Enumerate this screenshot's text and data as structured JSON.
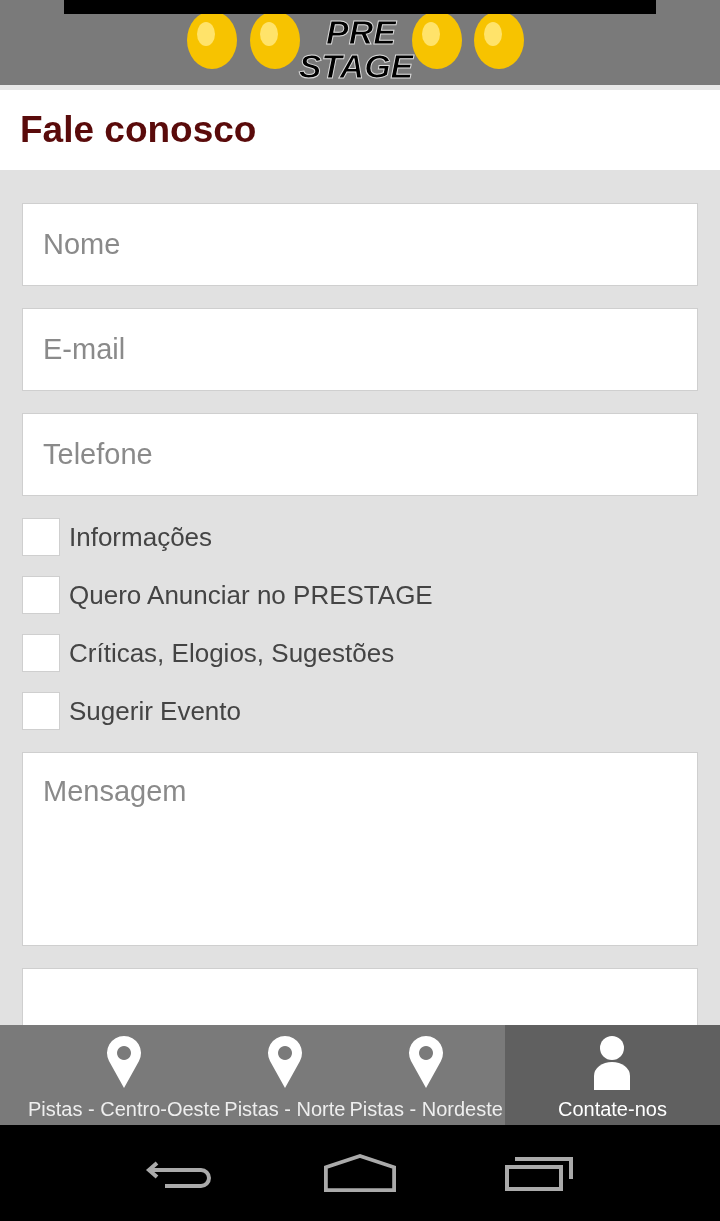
{
  "header": {
    "logo_lines": [
      "PRE",
      "STAGE"
    ]
  },
  "page_title": "Fale conosco",
  "fields": [
    {
      "placeholder": "Nome"
    },
    {
      "placeholder": "E-mail"
    },
    {
      "placeholder": "Telefone"
    }
  ],
  "checkboxes": [
    {
      "label": "Informações",
      "checked": false
    },
    {
      "label": "Quero Anunciar no PRESTAGE",
      "checked": false
    },
    {
      "label": "Críticas, Elogios, Sugestões",
      "checked": false
    },
    {
      "label": "Sugerir Evento",
      "checked": false
    }
  ],
  "message": {
    "placeholder": "Mensagem"
  },
  "bottom_nav": [
    {
      "label": "Pistas - Centro-Oeste",
      "kind": "location",
      "selected": false
    },
    {
      "label": "Pistas - Norte",
      "kind": "location",
      "selected": false
    },
    {
      "label": "Pistas - Nordeste",
      "kind": "location",
      "selected": false
    },
    {
      "label": "Contate-nos",
      "kind": "contact",
      "selected": true
    }
  ]
}
